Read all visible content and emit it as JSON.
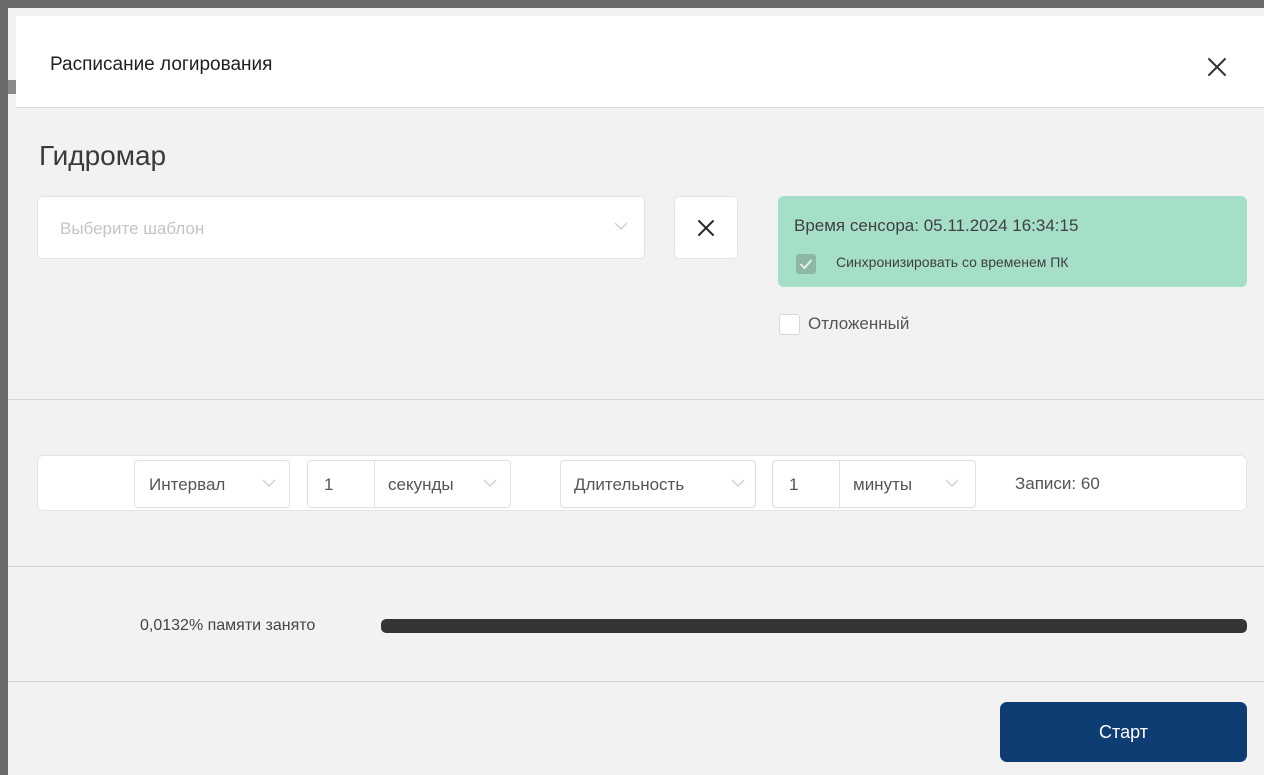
{
  "dialog": {
    "title": "Расписание логирования",
    "close_icon": "close-icon"
  },
  "device": {
    "name": "Гидромар"
  },
  "template": {
    "placeholder": "Выберите шаблон",
    "chevron_icon": "chevron-down-icon",
    "clear_icon": "close-icon"
  },
  "sensor": {
    "time_label": "Время сенсора: 05.11.2024 16:34:15",
    "sync_label": "Синхронизировать со временем ПК",
    "sync_checked": true,
    "background_color": "#a6dfc7"
  },
  "delayed": {
    "label": "Отложенный",
    "checked": false
  },
  "schedule": {
    "interval_label": "Интервал",
    "interval_value": "1",
    "interval_unit": "секунды",
    "duration_label": "Длительность",
    "duration_value": "1",
    "duration_unit": "минуты",
    "records_label": "Записи: 60"
  },
  "memory": {
    "label": "0,0132% памяти занято",
    "used_percent": 0.0132,
    "bar_color": "#353535"
  },
  "actions": {
    "start_label": "Старт",
    "start_color": "#0e3d73"
  }
}
